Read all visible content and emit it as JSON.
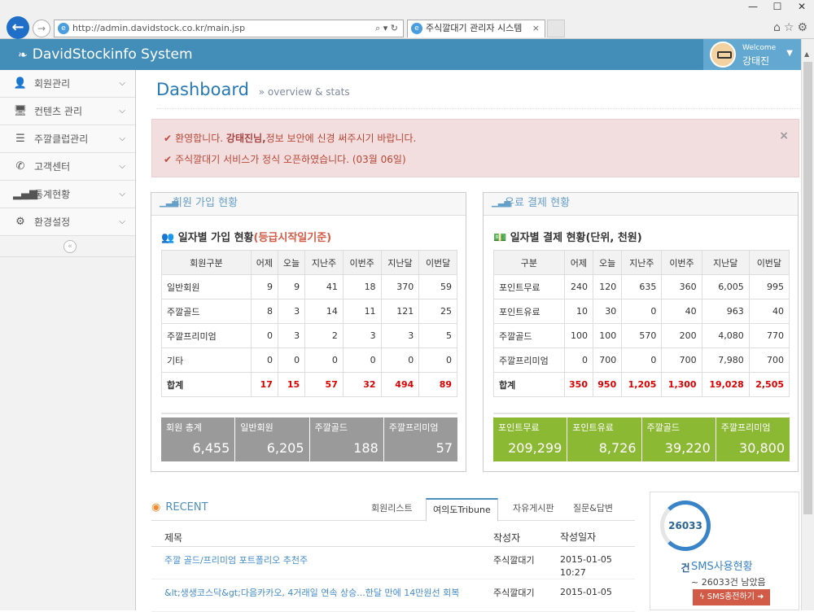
{
  "browser": {
    "url": "http://admin.davidstock.co.kr/main.jsp",
    "tab_title": "주식깔대기 관리자 시스템"
  },
  "app": {
    "brand": "DavidStockinfo System",
    "welcome": "Welcome",
    "user_name": "강태진"
  },
  "sidebar": {
    "items": [
      {
        "label": "회원관리",
        "icon": "user-icon"
      },
      {
        "label": "컨텐츠 관리",
        "icon": "desktop-icon"
      },
      {
        "label": "주깔클럽관리",
        "icon": "list-icon"
      },
      {
        "label": "고객센터",
        "icon": "phone-icon"
      },
      {
        "label": "통계현황",
        "icon": "signal-icon"
      },
      {
        "label": "환경설정",
        "icon": "cogs-icon"
      }
    ]
  },
  "page": {
    "title": "Dashboard",
    "subtitle": "» overview & stats"
  },
  "alert": {
    "line1_pre": "환영합니다.",
    "line1_name": "강태진님,",
    "line1_post": "정보 보안에 신경 써주시기 바랍니다.",
    "line2": "주식깔대기 서비스가 정식 오픈하였습니다. (03월 06일)"
  },
  "members_box": {
    "header": "회원 가입 현황",
    "title": "일자별 가입 현황",
    "title_highlight": "(등급시작일기준)",
    "columns": [
      "회원구분",
      "어제",
      "오늘",
      "지난주",
      "이번주",
      "지난달",
      "이번달"
    ],
    "rows": [
      [
        "일반회원",
        "9",
        "9",
        "41",
        "18",
        "370",
        "59"
      ],
      [
        "주깔골드",
        "8",
        "3",
        "14",
        "11",
        "121",
        "25"
      ],
      [
        "주깔프리미엄",
        "0",
        "3",
        "2",
        "3",
        "3",
        "5"
      ],
      [
        "기타",
        "0",
        "0",
        "0",
        "0",
        "0",
        "0"
      ]
    ],
    "total": [
      "합계",
      "17",
      "15",
      "57",
      "32",
      "494",
      "89"
    ],
    "stats": [
      {
        "label": "회원 총계",
        "value": "6,455"
      },
      {
        "label": "일반회원",
        "value": "6,205"
      },
      {
        "label": "주깔골드",
        "value": "188"
      },
      {
        "label": "주깔프리미엄",
        "value": "57"
      }
    ],
    "stat_color": "#9a9a9a"
  },
  "payments_box": {
    "header": "유료 결제 현황",
    "title": "일자별 결제 현황(단위, 천원)",
    "columns": [
      "구분",
      "어제",
      "오늘",
      "지난주",
      "이번주",
      "지난달",
      "이번달"
    ],
    "rows": [
      [
        "포인트무료",
        "240",
        "120",
        "635",
        "360",
        "6,005",
        "995"
      ],
      [
        "포인트유료",
        "10",
        "30",
        "0",
        "40",
        "963",
        "40"
      ],
      [
        "주깔골드",
        "100",
        "100",
        "570",
        "200",
        "4,080",
        "770"
      ],
      [
        "주깔프리미엄",
        "0",
        "700",
        "0",
        "700",
        "7,980",
        "700"
      ]
    ],
    "total": [
      "합계",
      "350",
      "950",
      "1,205",
      "1,300",
      "19,028",
      "2,505"
    ],
    "stats": [
      {
        "label": "포인트무료",
        "value": "209,299"
      },
      {
        "label": "포인트유료",
        "value": "8,726"
      },
      {
        "label": "주깔골드",
        "value": "39,220"
      },
      {
        "label": "주깔프리미엄",
        "value": "30,800"
      }
    ],
    "stat_color": "#8cb934"
  },
  "recent": {
    "title": "RECENT",
    "tabs": [
      "회원리스트",
      "여의도Tribune",
      "자유게시판",
      "질문&답변"
    ],
    "active_tab": 1,
    "columns": [
      "제목",
      "작성자",
      "작성일자"
    ],
    "rows": [
      {
        "title": "주깔 골드/프리미엄 포트폴리오 추천주",
        "author": "주식깔대기",
        "date": "2015-01-05 10:27"
      },
      {
        "title": "&lt;생생코스닥&gt;다음카카오, 4거래일 연속 상승...한달 만에 14만원선 회복",
        "author": "주식깔대기",
        "date": "2015-01-05"
      }
    ]
  },
  "sms": {
    "count": "26033건",
    "title": "SMS사용현황",
    "remaining": "~ 26033건 남았음",
    "button": "SMS충전하기"
  }
}
